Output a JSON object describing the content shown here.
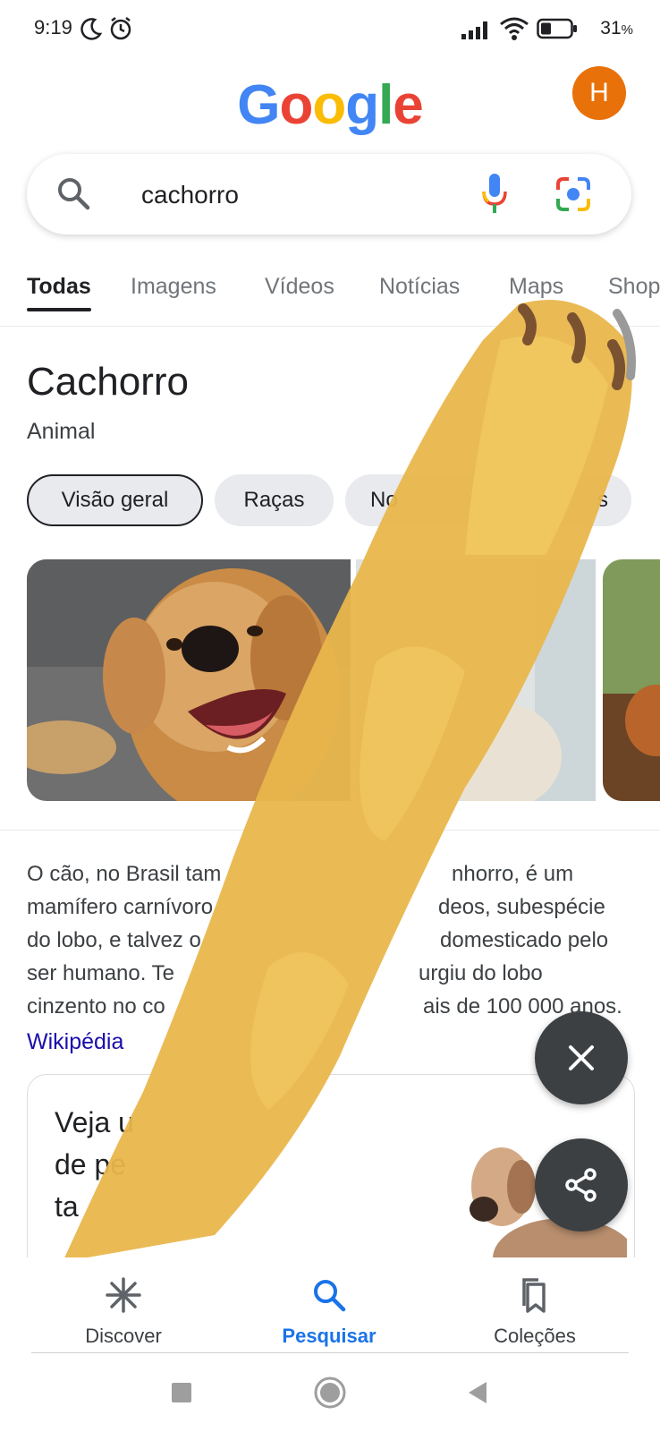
{
  "status_bar": {
    "time": "9:19",
    "battery_percent": "31",
    "battery_suffix": "%",
    "icons": [
      "moon-icon",
      "alarm-icon",
      "signal-icon",
      "wifi-icon",
      "battery-icon"
    ]
  },
  "header": {
    "logo_letters": [
      "G",
      "o",
      "o",
      "g",
      "l",
      "e"
    ],
    "logo_colors": [
      "#4285F4",
      "#EA4335",
      "#FBBC05",
      "#4285F4",
      "#34A853",
      "#EA4335"
    ],
    "avatar_initial": "H",
    "avatar_color": "#E8710A"
  },
  "search": {
    "query": "cachorro",
    "icons": [
      "search-icon",
      "mic-icon",
      "lens-icon"
    ]
  },
  "tabs": [
    {
      "label": "Todas",
      "active": true
    },
    {
      "label": "Imagens"
    },
    {
      "label": "Vídeos"
    },
    {
      "label": "Notícias"
    },
    {
      "label": "Maps"
    },
    {
      "label": "Shop"
    }
  ],
  "knowledge_panel": {
    "title": "Cachorro",
    "subtitle": "Animal",
    "chips": [
      "Visão geral",
      "Raças",
      "No",
      "s"
    ],
    "description_lines": [
      "O cão, no Brasil tam",
      "nhorro, é um",
      "mamífero carnívoro",
      "deos, subespécie",
      "do lobo, e talvez o",
      "domesticado pelo",
      "ser humano. Te",
      "urgiu do lobo",
      "cinzento no co",
      "ais de 100 000 anos."
    ],
    "source": "Wikipédia",
    "card_lines": [
      "Veja u",
      "de pe",
      "ta"
    ]
  },
  "fabs": {
    "close_icon": "close-icon",
    "share_icon": "share-icon"
  },
  "bottom_nav": [
    {
      "label": "Discover",
      "icon": "asterisk-icon"
    },
    {
      "label": "Pesquisar",
      "icon": "search-icon",
      "active": true
    },
    {
      "label": "Coleções",
      "icon": "bookmarks-icon"
    }
  ],
  "colors": {
    "accent_blue": "#1A73E8",
    "link_blue": "#1A0DAB",
    "fab_dark": "#3C4043",
    "overlay_yellow": "#E9B64C"
  }
}
